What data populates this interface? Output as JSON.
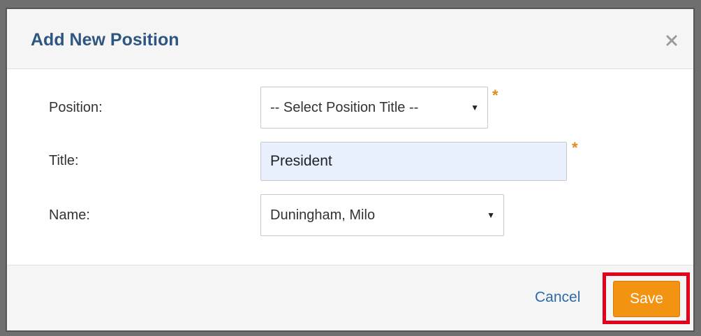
{
  "dialog": {
    "title": "Add New Position"
  },
  "form": {
    "position": {
      "label": "Position:",
      "selected": "-- Select Position Title --",
      "required_marker": "*"
    },
    "title": {
      "label": "Title:",
      "value": "President",
      "required_marker": "*"
    },
    "name": {
      "label": "Name:",
      "selected": "Duningham, Milo"
    }
  },
  "footer": {
    "cancel_label": "Cancel",
    "save_label": "Save"
  },
  "colors": {
    "title": "#2e5680",
    "accent_orange": "#f39312",
    "required": "#e08a1e",
    "highlight": "#e3001b",
    "link": "#2e6aa6",
    "autofill": "#e8f0fe"
  },
  "icons": {
    "close": "close-icon",
    "dropdown": "chevron-down-icon"
  }
}
